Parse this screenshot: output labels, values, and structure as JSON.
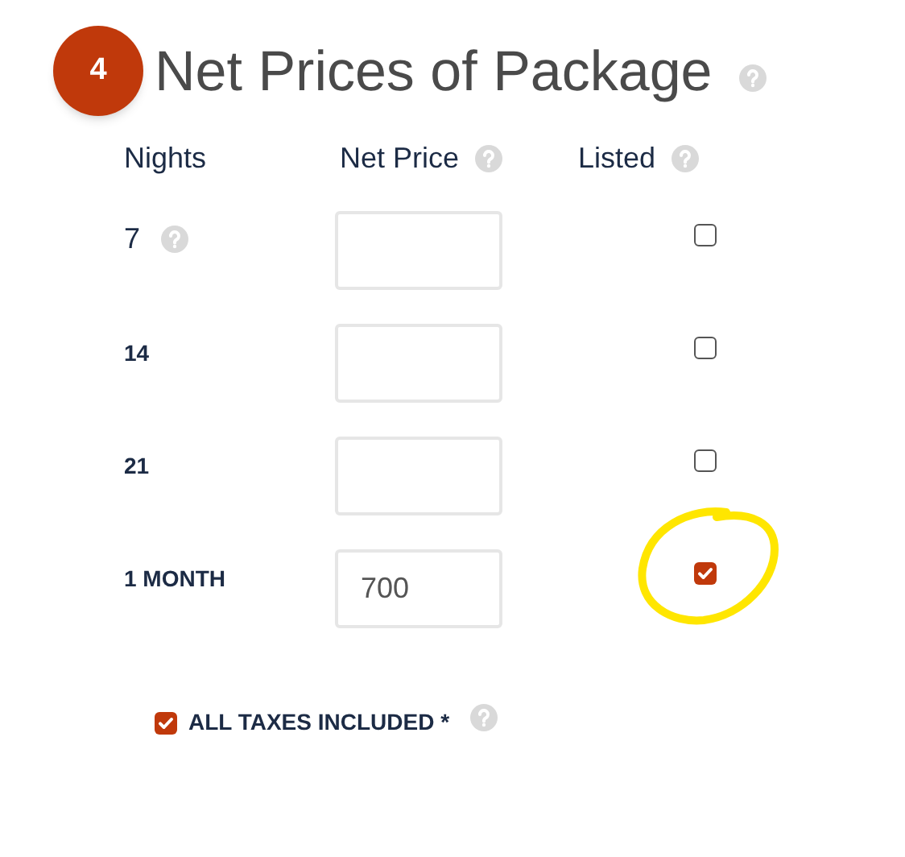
{
  "step": {
    "number": "4",
    "title": "Net Prices of Package"
  },
  "columns": [
    "Nights",
    "Net Price",
    "Listed"
  ],
  "rows": [
    {
      "kind": "help",
      "nights": "7",
      "listed": false,
      "highlighted": false
    },
    {
      "kind": "plain",
      "nights": "14",
      "listed": false,
      "highlighted": false
    },
    {
      "kind": "plain",
      "nights": "21",
      "listed": false,
      "highlighted": false
    },
    {
      "kind": "plain",
      "nights": "1 MONTH",
      "price": "700",
      "listed": true,
      "highlighted": true
    }
  ],
  "taxes": {
    "label": "ALL TAXES INCLUDED *",
    "checked": true
  }
}
